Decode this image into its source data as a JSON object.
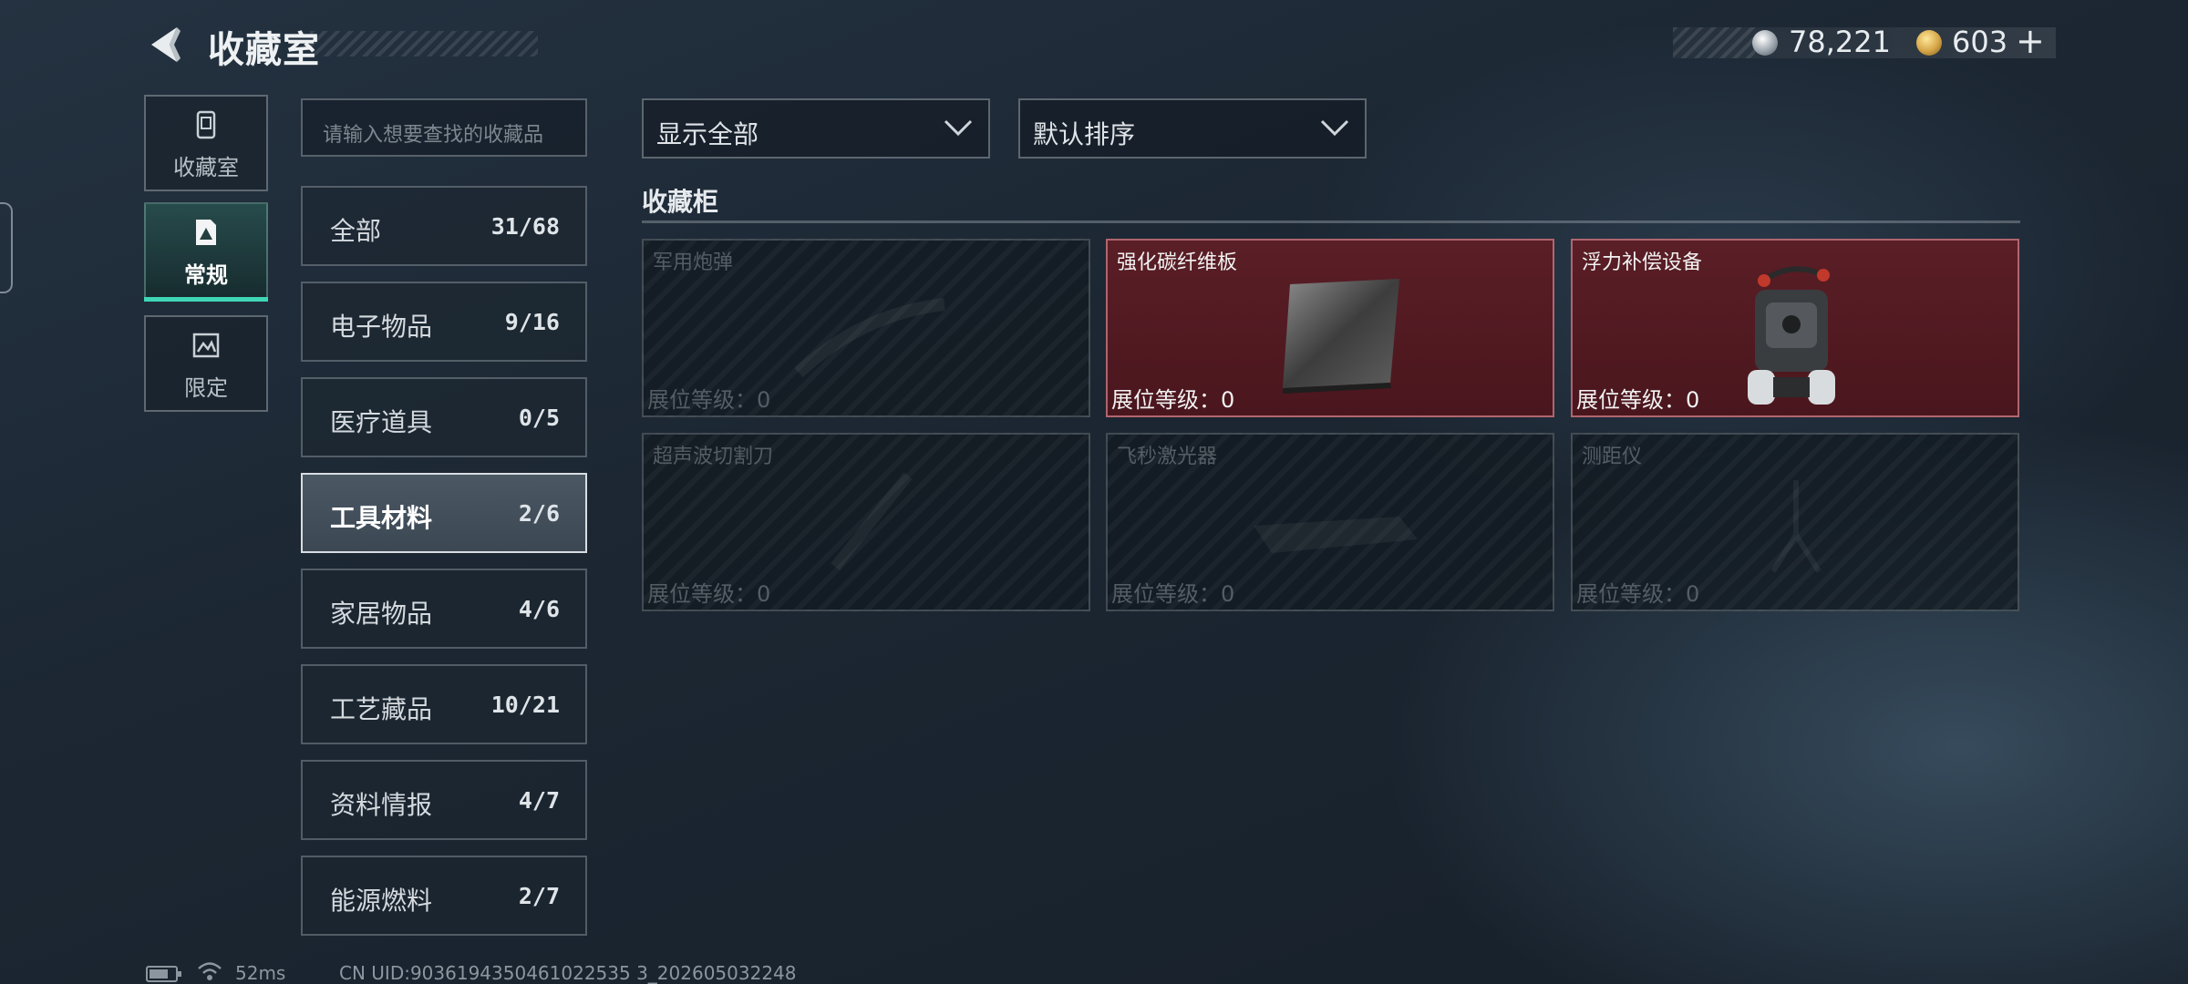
{
  "header": {
    "title": "收藏室"
  },
  "currency": {
    "silver": "78,221",
    "gold": "603",
    "add_label": "+"
  },
  "nav": [
    {
      "label": "收藏室",
      "icon": "cabinet-icon"
    },
    {
      "label": "常规",
      "icon": "regular-collection-icon"
    },
    {
      "label": "限定",
      "icon": "limited-collection-icon"
    }
  ],
  "search": {
    "placeholder": "请输入想要查找的收藏品"
  },
  "categories": [
    {
      "name": "全部",
      "count": "31/68"
    },
    {
      "name": "电子物品",
      "count": "9/16"
    },
    {
      "name": "医疗道具",
      "count": "0/5"
    },
    {
      "name": "工具材料",
      "count": "2/6"
    },
    {
      "name": "家居物品",
      "count": "4/6"
    },
    {
      "name": "工艺藏品",
      "count": "10/21"
    },
    {
      "name": "资料情报",
      "count": "4/7"
    },
    {
      "name": "能源燃料",
      "count": "2/7"
    }
  ],
  "filters": {
    "show": "显示全部",
    "sort": "默认排序"
  },
  "section": {
    "title": "收藏柜"
  },
  "slots": [
    {
      "name": "军用炮弹",
      "level": "展位等级：0",
      "filled": false
    },
    {
      "name": "强化碳纤维板",
      "level": "展位等级：0",
      "filled": true
    },
    {
      "name": "浮力补偿设备",
      "level": "展位等级：0",
      "filled": true
    },
    {
      "name": "超声波切割刀",
      "level": "展位等级：0",
      "filled": false
    },
    {
      "name": "飞秒激光器",
      "level": "展位等级：0",
      "filled": false
    },
    {
      "name": "测距仪",
      "level": "展位等级：0",
      "filled": false
    }
  ],
  "status": {
    "ping": "52ms",
    "uid": "CN UID:9036194350461022535 3_202605032248"
  },
  "colors": {
    "accent": "#3fd6b5",
    "filled_slot": "#4f1a21"
  }
}
